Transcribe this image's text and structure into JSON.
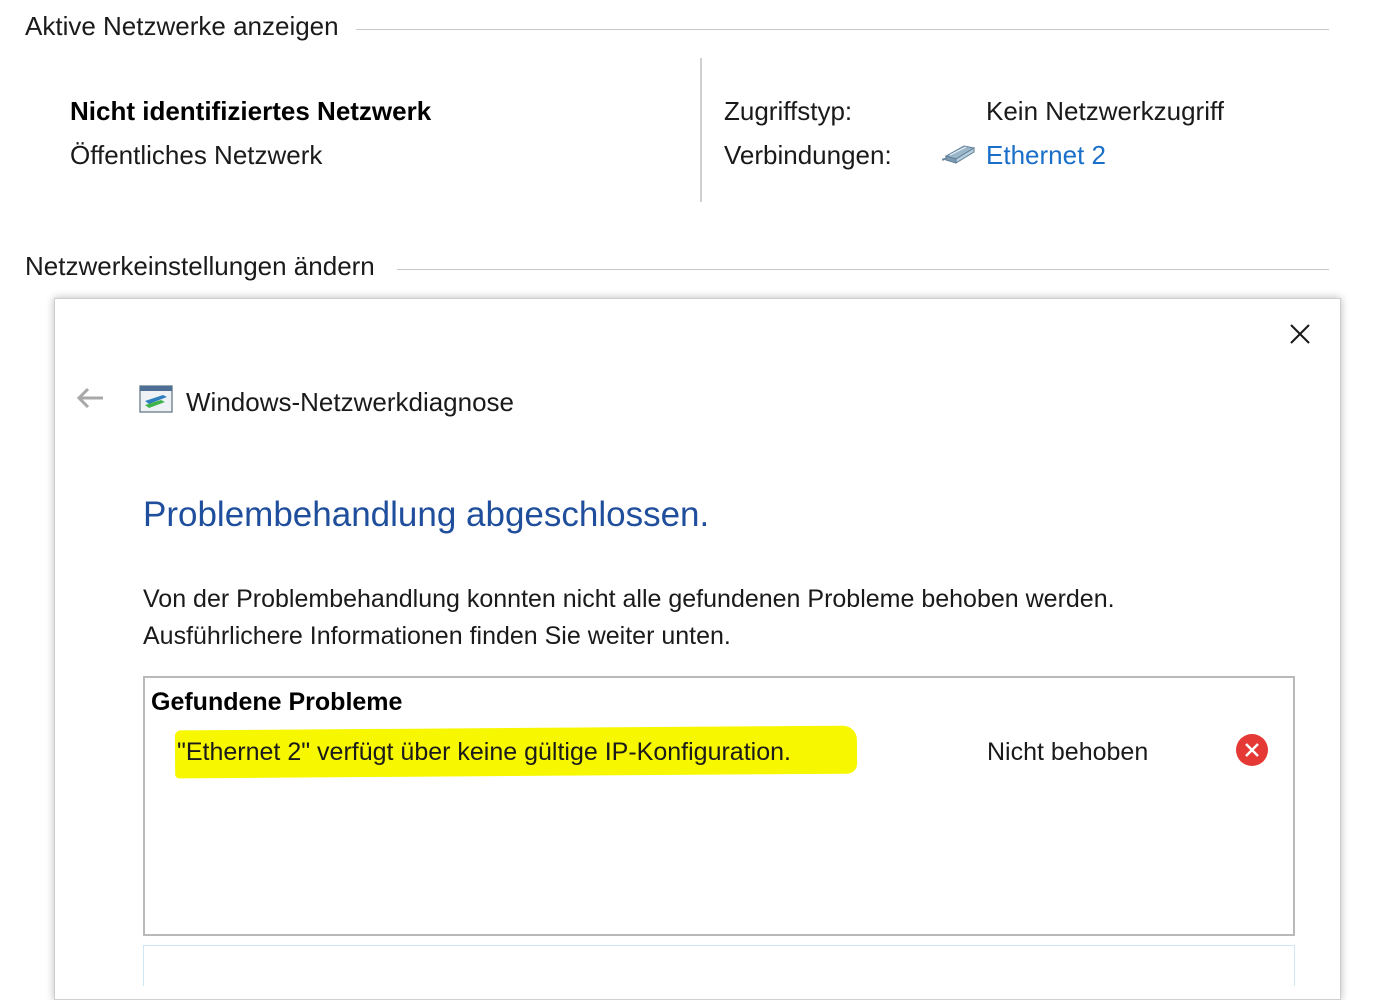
{
  "active_networks": {
    "section_title": "Aktive Netzwerke anzeigen",
    "network_name": "Nicht identifiziertes Netzwerk",
    "network_type": "Öffentliches Netzwerk",
    "access_type_label": "Zugriffstyp:",
    "access_type_value": "Kein Netzwerkzugriff",
    "connections_label": "Verbindungen:",
    "connection_link": "Ethernet 2",
    "connection_icon": "ethernet-adapter-icon"
  },
  "change_settings": {
    "section_title": "Netzwerkeinstellungen ändern"
  },
  "dialog": {
    "app_title": "Windows-Netzwerkdiagnose",
    "back_icon": "back-arrow-icon",
    "app_icon": "network-diagnostics-icon",
    "close_icon": "close-icon",
    "heading": "Problembehandlung abgeschlossen.",
    "description_line1": "Von der Problembehandlung konnten nicht alle gefundenen Probleme behoben werden.",
    "description_line2": "Ausführlichere Informationen finden Sie weiter unten.",
    "problems": {
      "header": "Gefundene Probleme",
      "items": [
        {
          "text": "\"Ethernet 2\" verfügt über keine gültige IP-Konfiguration.",
          "status": "Nicht behoben",
          "status_icon": "error-x-icon"
        }
      ]
    }
  },
  "colors": {
    "link": "#1a6fc9",
    "heading": "#1f4e9c",
    "highlight": "#f7f700",
    "error": "#e53935"
  }
}
